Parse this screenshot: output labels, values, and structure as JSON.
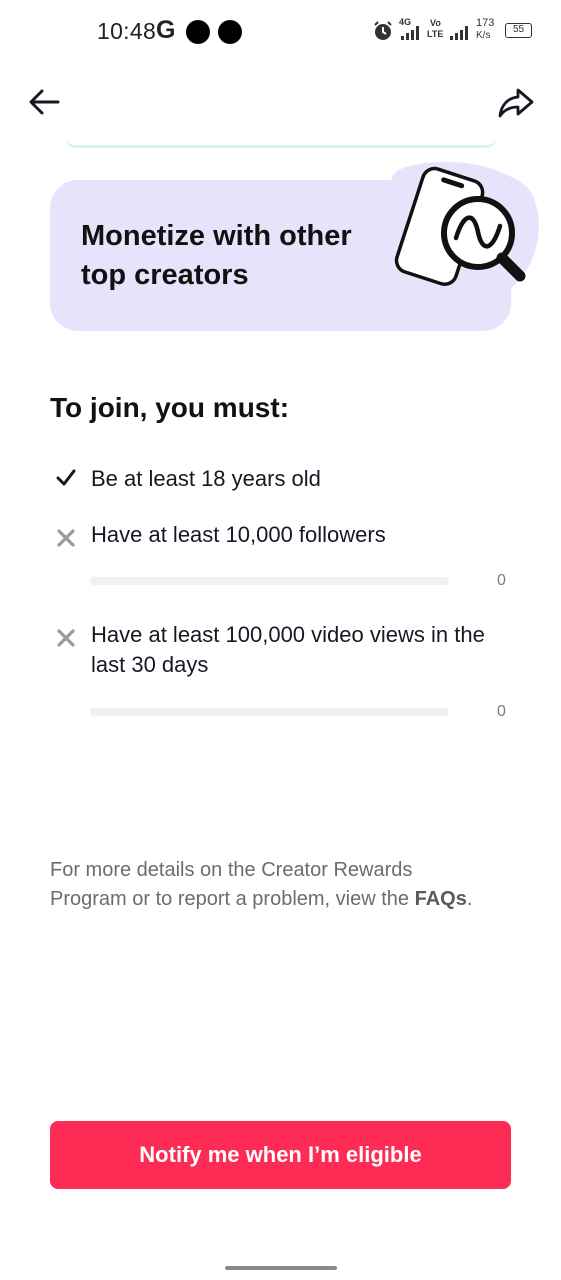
{
  "status_bar": {
    "time": "10:48",
    "g_label": "G",
    "net_4g": "4G",
    "volte_top": "Vo",
    "volte_bottom": "LTE",
    "speed_value": "173",
    "speed_unit": "K/s",
    "battery": "55"
  },
  "header": {
    "back_icon": "arrow-left-icon",
    "share_icon": "share-arrow-icon"
  },
  "banner": {
    "title": "Monetize with other top creators",
    "illustration": "phone-magnifier-graph-icon",
    "background": "#e5e4fb"
  },
  "requirements": {
    "title": "To join, you must:",
    "items": [
      {
        "status": "met",
        "icon": "check-icon",
        "text": "Be at least 18 years old"
      },
      {
        "status": "unmet",
        "icon": "x-icon",
        "text": "Have at least 10,000 followers",
        "progress": 0,
        "count": "0"
      },
      {
        "status": "unmet",
        "icon": "x-icon",
        "text": "Have at least 100,000 video views in the last 30 days",
        "progress": 0,
        "count": "0"
      }
    ]
  },
  "footer": {
    "note": "For more details on the Creator Rewards Program or to report a problem, view the ",
    "faq_link": "FAQs",
    "note_end": "."
  },
  "cta": {
    "label": "Notify me when I’m eligible",
    "color": "#fe2c55"
  }
}
